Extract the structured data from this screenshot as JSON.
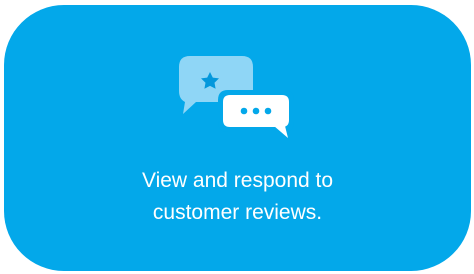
{
  "card": {
    "background_color": "#03a8ea",
    "icon": "chat-bubbles-review-icon",
    "message_lines": [
      "View and respond to",
      "customer reviews."
    ]
  }
}
